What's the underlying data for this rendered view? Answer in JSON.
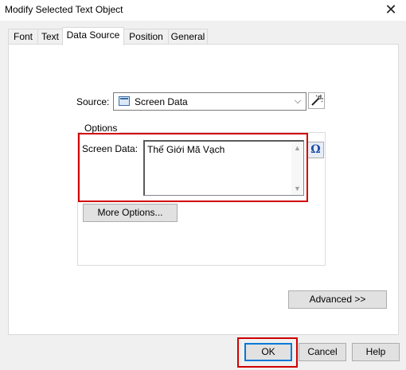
{
  "window": {
    "title": "Modify Selected Text Object",
    "close_glyph": "✕"
  },
  "tabs": [
    {
      "label": "Font"
    },
    {
      "label": "Text"
    },
    {
      "label": "Data Source",
      "active": true
    },
    {
      "label": "Position"
    },
    {
      "label": "General"
    }
  ],
  "source": {
    "label": "Source:",
    "selected": "Screen Data",
    "chevron": "⌵"
  },
  "options": {
    "legend": "Options",
    "screen_data_label": "Screen Data:",
    "screen_data_value": "Thế Giới Mã Vạch",
    "omega_glyph": "Ω",
    "more_options_label": "More Options..."
  },
  "advanced_label": "Advanced >>",
  "footer": {
    "ok_label": "OK",
    "cancel_label": "Cancel",
    "help_label": "Help"
  },
  "colors": {
    "highlight": "#d10000",
    "accent": "#0078d7"
  }
}
